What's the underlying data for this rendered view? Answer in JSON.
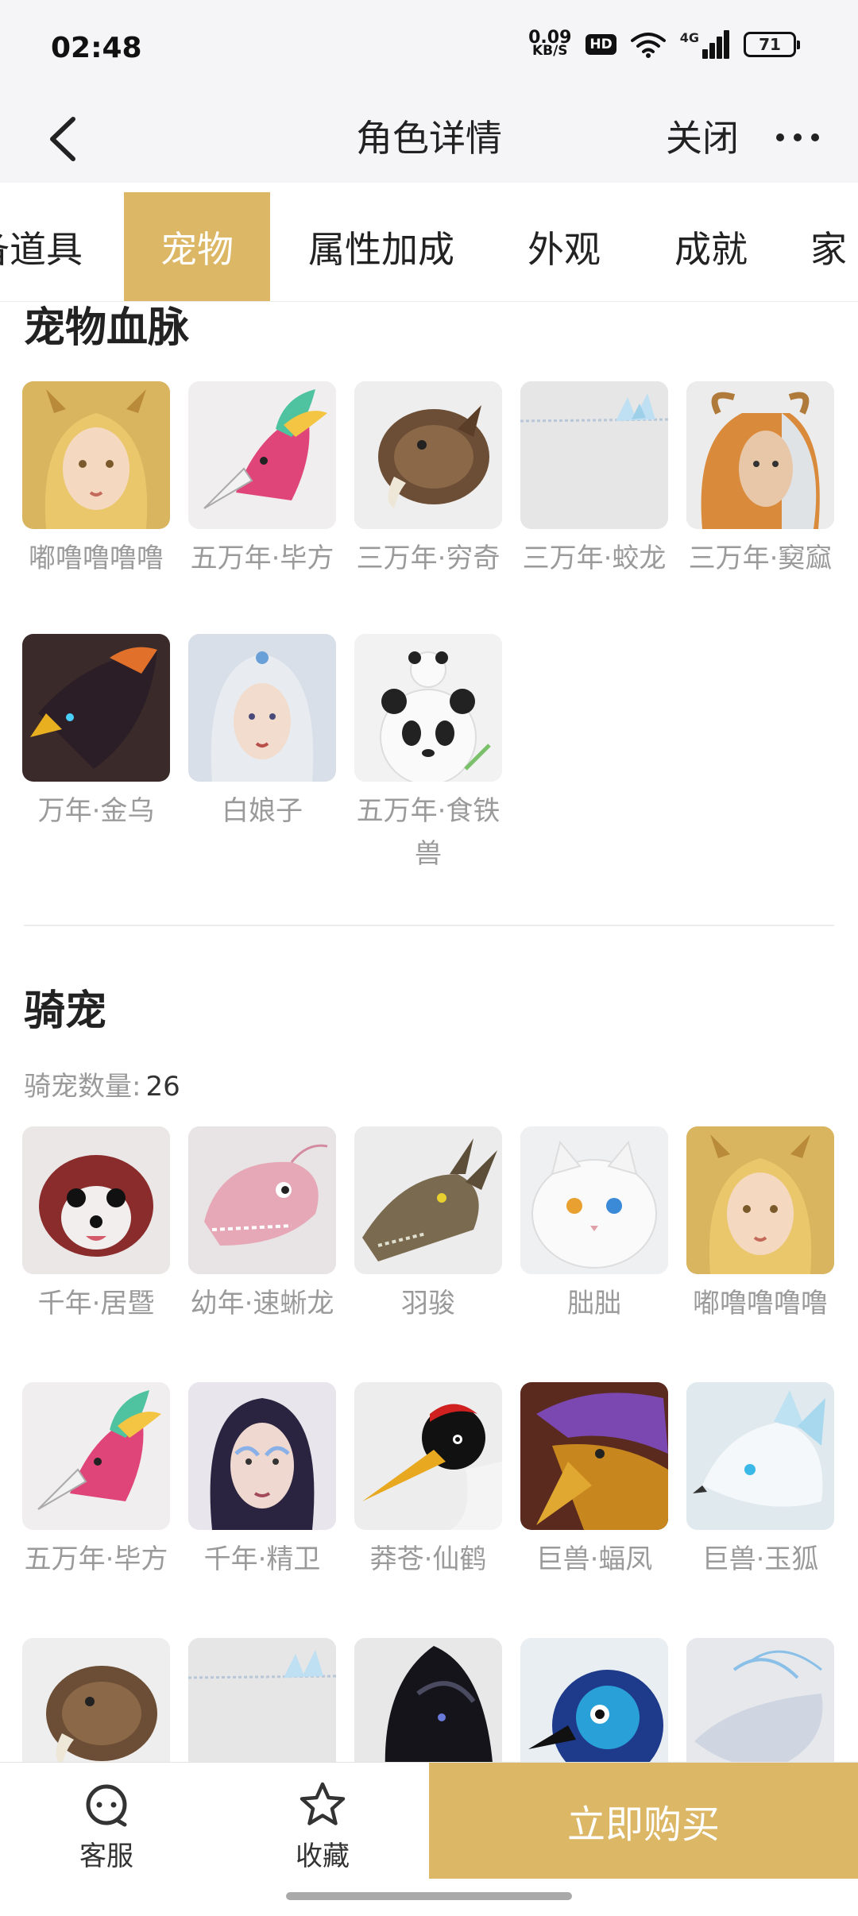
{
  "status_bar": {
    "time": "02:48",
    "net_speed_value": "0.09",
    "net_speed_unit": "KB/S",
    "hd": "HD",
    "network": "4G",
    "battery": "71"
  },
  "nav": {
    "title": "角色详情",
    "close_label": "关闭"
  },
  "tabs": [
    {
      "label": "备道具"
    },
    {
      "label": "宠物"
    },
    {
      "label": "属性加成"
    },
    {
      "label": "外观"
    },
    {
      "label": "成就"
    },
    {
      "label": "家"
    }
  ],
  "pet_bloodline": {
    "title": "宠物血脉",
    "items": [
      {
        "name": "嘟噜噜噜噜",
        "icon": "golden-haired-girl-icon"
      },
      {
        "name": "五万年·毕方",
        "icon": "bifang-bird-icon"
      },
      {
        "name": "三万年·穷奇",
        "icon": "qiongqi-beast-icon"
      },
      {
        "name": "三万年·蛟龙",
        "icon": "jiaolong-image-icon"
      },
      {
        "name": "三万年·窫窳",
        "icon": "yayu-horned-face-icon"
      },
      {
        "name": "万年·金乌",
        "icon": "golden-crow-icon"
      },
      {
        "name": "白娘子",
        "icon": "white-lady-icon"
      },
      {
        "name": "五万年·食铁兽",
        "icon": "panda-icon"
      }
    ]
  },
  "mounts": {
    "title": "骑宠",
    "count_label": "骑宠数量:",
    "count_value": "26",
    "items": [
      {
        "name": "千年·居暨",
        "icon": "red-hedgehog-icon"
      },
      {
        "name": "幼年·速蜥龙",
        "icon": "pink-raptor-icon"
      },
      {
        "name": "羽骏",
        "icon": "dragon-head-icon"
      },
      {
        "name": "朏朏",
        "icon": "white-cat-icon"
      },
      {
        "name": "嘟噜噜噜噜",
        "icon": "golden-haired-girl-icon"
      },
      {
        "name": "五万年·毕方",
        "icon": "bifang-bird-icon"
      },
      {
        "name": "千年·精卫",
        "icon": "jingwei-face-icon"
      },
      {
        "name": "莽苍·仙鹤",
        "icon": "crane-icon"
      },
      {
        "name": "巨兽·蝠凤",
        "icon": "bat-phoenix-icon"
      },
      {
        "name": "巨兽·玉狐",
        "icon": "jade-fox-icon"
      },
      {
        "name": "",
        "icon": "qiongqi-beast-icon"
      },
      {
        "name": "",
        "icon": "jiaolong-image-icon"
      },
      {
        "name": "",
        "icon": "black-dragon-icon"
      },
      {
        "name": "",
        "icon": "blue-bird-icon"
      },
      {
        "name": "",
        "icon": "ice-dragon-icon"
      }
    ]
  },
  "bottom_bar": {
    "service_label": "客服",
    "favorite_label": "收藏",
    "buy_label": "立即购买"
  },
  "colors": {
    "accent": "#dcb766",
    "muted_text": "#9a9a9a",
    "nav_background": "#f5f5f7"
  }
}
